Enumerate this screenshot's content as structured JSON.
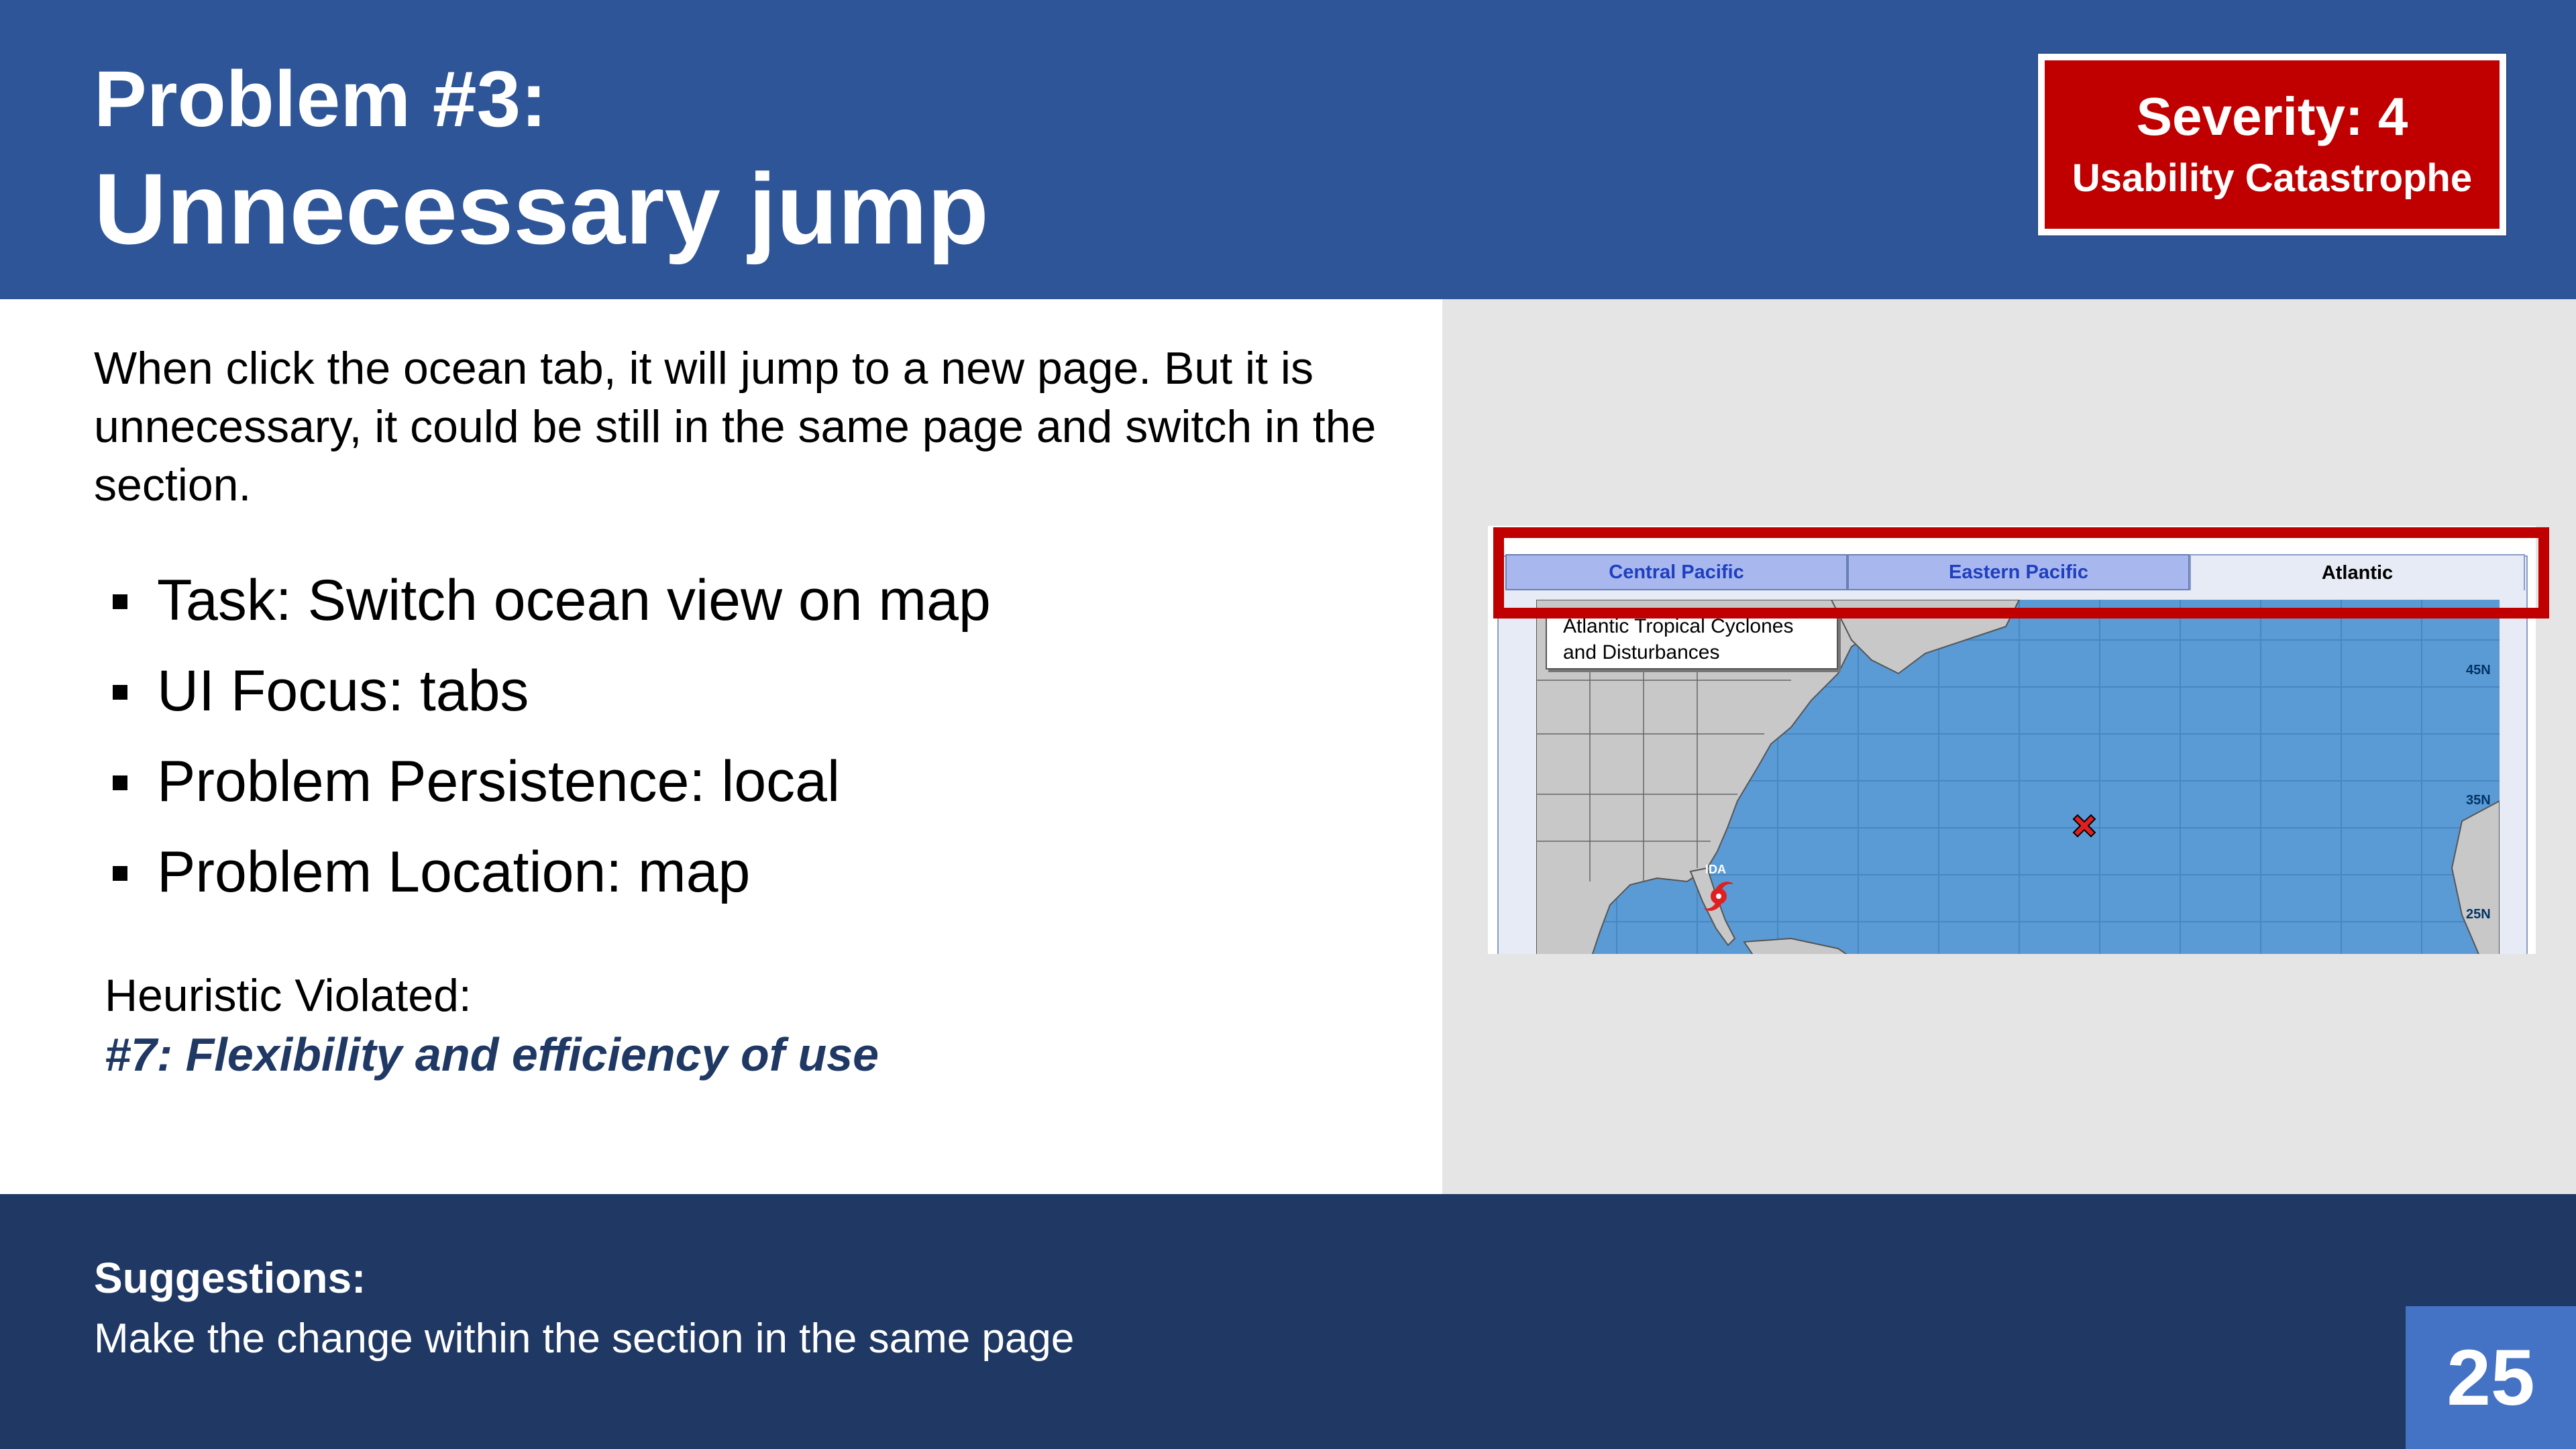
{
  "header": {
    "title_small": "Problem #3:",
    "title_big": "Unnecessary jump"
  },
  "severity": {
    "label": "Severity: 4",
    "sub": "Usability Catastrophe",
    "color": "#c00000"
  },
  "intro": "When click the ocean tab, it will jump to a new page. But it is unnecessary, it could be still in the same page and switch in the section.",
  "bullets": [
    "Task: Switch ocean view on map",
    "UI Focus: tabs",
    "Problem Persistence: local",
    "Problem Location: map"
  ],
  "heuristic": {
    "label": "Heuristic Violated:",
    "value": "#7: Flexibility and efficiency of use"
  },
  "suggestions": {
    "title": "Suggestions:",
    "text": "Make the change within the section in the same page"
  },
  "page_number": "25",
  "screenshot": {
    "tabs": [
      "Central Pacific",
      "Eastern Pacific",
      "Atlantic"
    ],
    "active_tab": "Atlantic",
    "map_label_line1": "Atlantic Tropical Cyclones",
    "map_label_line2": "and Disturbances",
    "latitudes": [
      "45N",
      "35N",
      "25N"
    ],
    "storm_name": "IDA"
  },
  "colors": {
    "header_blue": "#2e5597",
    "footer_navy": "#1f3864",
    "page_badge": "#4472c4",
    "heuristic_text": "#1f3864",
    "ocean": "#5b9bd5",
    "land": "#c8c8c8",
    "highlight": "#c00000"
  }
}
